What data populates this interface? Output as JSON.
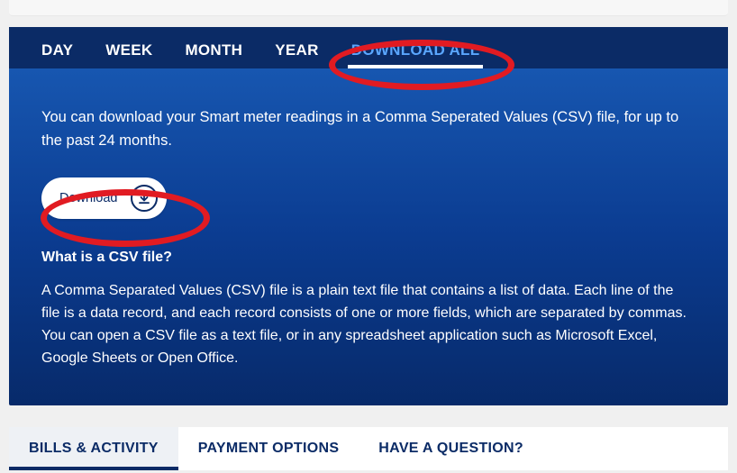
{
  "tabs": {
    "day": "DAY",
    "week": "WEEK",
    "month": "MONTH",
    "year": "YEAR",
    "download_all": "DOWNLOAD ALL"
  },
  "panel": {
    "intro": "You can download your Smart meter readings in a Comma Seperated Values (CSV) file, for up to the past 24 months.",
    "download_label": "Download",
    "csv_heading": "What is a CSV file?",
    "csv_body": "A Comma Separated Values (CSV) file is a plain text file that contains a list of data. Each line of the file is a data record, and each record consists of one or more fields, which are separated by commas. You can open a CSV file as a text file, or in any spreadsheet application such as Microsoft Excel, Google Sheets or Open Office."
  },
  "bottom_tabs": {
    "bills": "BILLS & ACTIVITY",
    "payment": "PAYMENT OPTIONS",
    "question": "HAVE A QUESTION?"
  }
}
